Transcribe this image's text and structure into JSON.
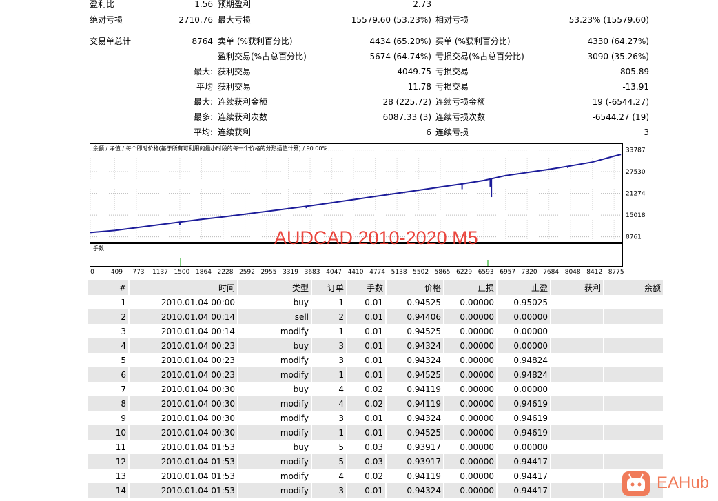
{
  "stats": {
    "r0": {
      "l1": "盈利比",
      "v1": "1.56",
      "l2": "预期盈利",
      "v2": "2.73"
    },
    "r1": {
      "l1": "绝对亏损",
      "v1": "2710.76",
      "l2": "最大亏损",
      "v2": "15579.60 (53.23%)",
      "l3": "相对亏损",
      "v3": "53.23% (15579.60)"
    },
    "r2": {
      "l1": "交易单总计",
      "v1": "8764",
      "l2": "卖单 (%获利百分比)",
      "v2": "4434 (65.20%)",
      "l3": "买单 (%获利百分比)",
      "v3": "4330 (64.27%)"
    },
    "r3": {
      "l2": "盈利交易(%占总百分比)",
      "v2": "5674 (64.74%)",
      "l3": "亏损交易(%占总百分比)",
      "v3": "3090 (35.26%)"
    },
    "r4": {
      "pre": "最大:",
      "l2": "获利交易",
      "v2": "4049.75",
      "l3": "亏损交易",
      "v3": "-805.89"
    },
    "r5": {
      "pre": "平均",
      "l2": "获利交易",
      "v2": "11.78",
      "l3": "亏损交易",
      "v3": "-13.91"
    },
    "r6": {
      "pre": "最大:",
      "l2": "连续获利金额",
      "v2": "28 (225.72)",
      "l3": "连续亏损金额",
      "v3": "19 (-6544.27)"
    },
    "r7": {
      "pre": "最多:",
      "l2": "连续获利次数",
      "v2": "6087.33 (3)",
      "l3": "连续亏损次数",
      "v3": "-6544.27 (19)"
    },
    "r8": {
      "pre": "平均:",
      "l2": "连续获利",
      "v2": "6",
      "l3": "连续亏损",
      "v3": "3"
    }
  },
  "chart_data": {
    "type": "line",
    "legend_text": "余额 / 净值 / 每个即时价格(基于所有可利用的最小时段的每一个价格的分形插值计算) / 90.00%",
    "legend_balance": "余额",
    "legend_equity": "净值",
    "lots_label": "手数",
    "yticks": [
      8761,
      15018,
      21274,
      27530,
      33787
    ],
    "ylim": [
      7500,
      35500
    ],
    "xticks": [
      0,
      409,
      773,
      1137,
      1500,
      1864,
      2228,
      2592,
      2955,
      3319,
      3683,
      4047,
      4410,
      4774,
      5138,
      5502,
      5865,
      6229,
      6593,
      6957,
      7320,
      7684,
      8048,
      8412,
      8775
    ],
    "xlim": [
      0,
      8900
    ],
    "x": [
      0,
      409,
      773,
      1137,
      1500,
      1864,
      2228,
      2592,
      2955,
      3319,
      3683,
      4047,
      4410,
      4774,
      5138,
      5502,
      5865,
      6229,
      6593,
      6957,
      7320,
      7684,
      8048,
      8412,
      8775,
      8890
    ],
    "y": [
      10000,
      10600,
      11400,
      12200,
      13000,
      13800,
      14500,
      15300,
      16100,
      16900,
      17700,
      18600,
      19500,
      20400,
      21300,
      22200,
      23100,
      24000,
      25000,
      26400,
      27300,
      28200,
      29200,
      30300,
      32000,
      32500
    ],
    "dips": [
      {
        "x": 1500,
        "y": 12200
      },
      {
        "x": 3000,
        "y": 16000
      },
      {
        "x": 3619,
        "y": 17000
      },
      {
        "x": 6229,
        "y": 22500
      },
      {
        "x": 6700,
        "y": 23200
      },
      {
        "x": 6720,
        "y": 20200
      },
      {
        "x": 8000,
        "y": 28600
      }
    ]
  },
  "watermark": "AUDCAD 2010-2020 M5",
  "logo_text": "EAHub",
  "table": {
    "headers": [
      "#",
      "时间",
      "类型",
      "订单",
      "手数",
      "价格",
      "止损",
      "止盈",
      "获利",
      "余额"
    ],
    "rows": [
      [
        "1",
        "2010.01.04 00:00",
        "buy",
        "1",
        "0.01",
        "0.94525",
        "0.00000",
        "0.95025",
        "",
        ""
      ],
      [
        "2",
        "2010.01.04 00:14",
        "sell",
        "2",
        "0.01",
        "0.94406",
        "0.00000",
        "0.00000",
        "",
        ""
      ],
      [
        "3",
        "2010.01.04 00:14",
        "modify",
        "1",
        "0.01",
        "0.94525",
        "0.00000",
        "0.00000",
        "",
        ""
      ],
      [
        "4",
        "2010.01.04 00:23",
        "buy",
        "3",
        "0.01",
        "0.94324",
        "0.00000",
        "0.00000",
        "",
        ""
      ],
      [
        "5",
        "2010.01.04 00:23",
        "modify",
        "3",
        "0.01",
        "0.94324",
        "0.00000",
        "0.94824",
        "",
        ""
      ],
      [
        "6",
        "2010.01.04 00:23",
        "modify",
        "1",
        "0.01",
        "0.94525",
        "0.00000",
        "0.94824",
        "",
        ""
      ],
      [
        "7",
        "2010.01.04 00:30",
        "buy",
        "4",
        "0.02",
        "0.94119",
        "0.00000",
        "0.00000",
        "",
        ""
      ],
      [
        "8",
        "2010.01.04 00:30",
        "modify",
        "4",
        "0.02",
        "0.94119",
        "0.00000",
        "0.94619",
        "",
        ""
      ],
      [
        "9",
        "2010.01.04 00:30",
        "modify",
        "3",
        "0.01",
        "0.94324",
        "0.00000",
        "0.94619",
        "",
        ""
      ],
      [
        "10",
        "2010.01.04 00:30",
        "modify",
        "1",
        "0.01",
        "0.94525",
        "0.00000",
        "0.94619",
        "",
        ""
      ],
      [
        "11",
        "2010.01.04 01:53",
        "buy",
        "5",
        "0.03",
        "0.93917",
        "0.00000",
        "0.00000",
        "",
        ""
      ],
      [
        "12",
        "2010.01.04 01:53",
        "modify",
        "5",
        "0.03",
        "0.93917",
        "0.00000",
        "0.94417",
        "",
        ""
      ],
      [
        "13",
        "2010.01.04 01:53",
        "modify",
        "4",
        "0.02",
        "0.94119",
        "0.00000",
        "0.94417",
        "",
        ""
      ],
      [
        "14",
        "2010.01.04 01:53",
        "modify",
        "3",
        "0.01",
        "0.94324",
        "0.00000",
        "0.94417",
        "",
        ""
      ]
    ]
  }
}
